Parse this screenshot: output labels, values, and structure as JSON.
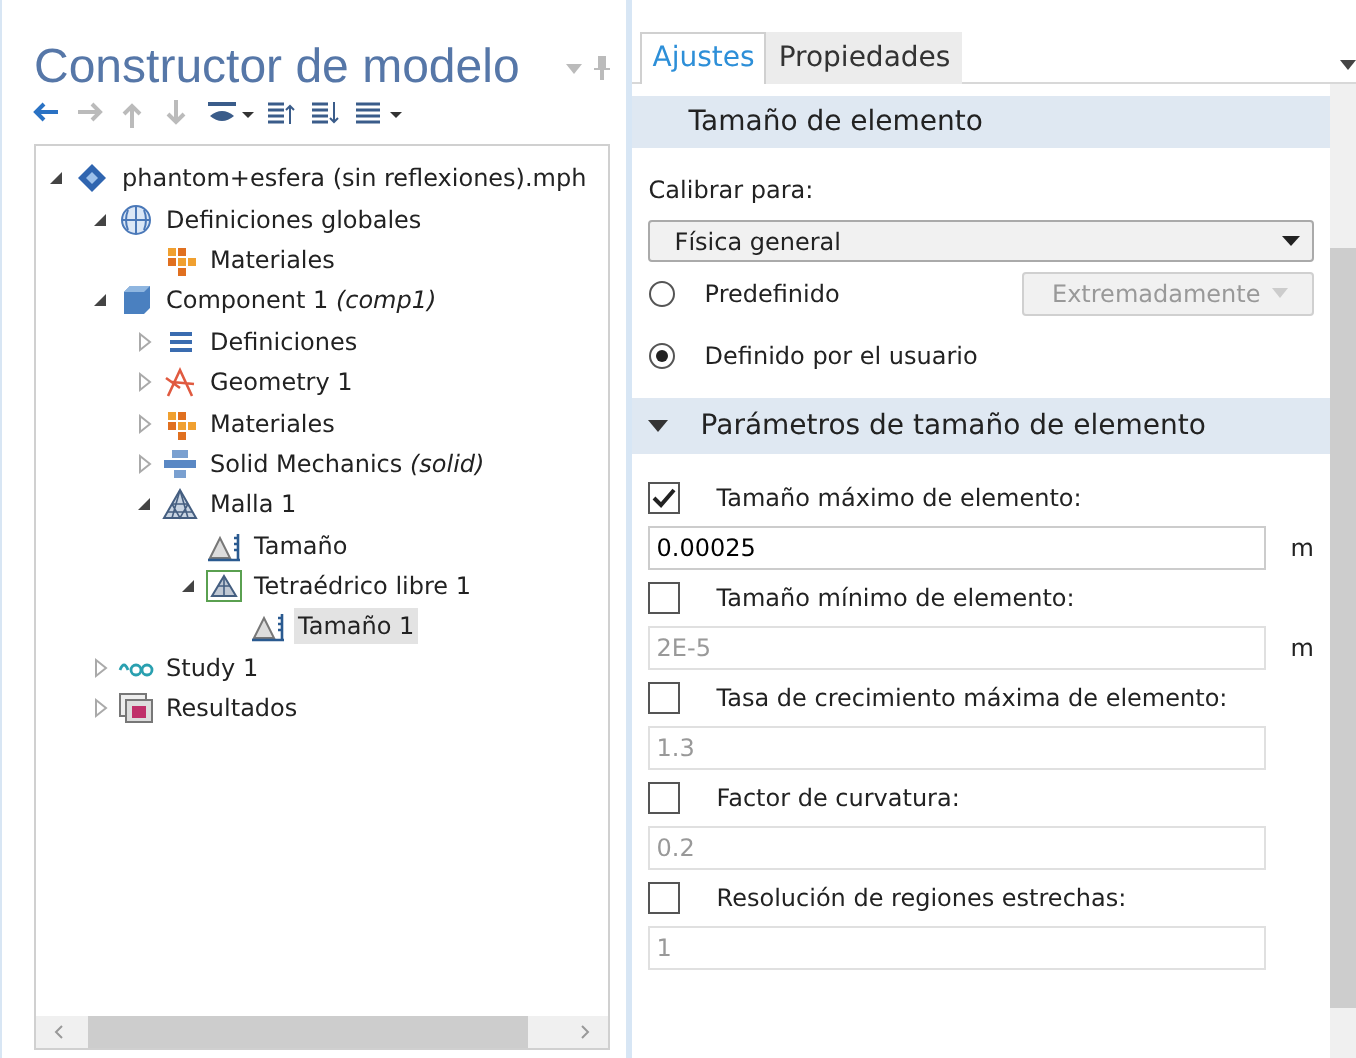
{
  "model_builder": {
    "title": "Constructor de modelo",
    "toolbar": [
      {
        "kind": "back",
        "disabled": false
      },
      {
        "kind": "forward",
        "disabled": true
      },
      {
        "kind": "up",
        "disabled": true
      },
      {
        "kind": "down",
        "disabled": true
      },
      {
        "kind": "show",
        "disabled": false,
        "menu": true
      },
      {
        "kind": "expand",
        "disabled": false
      },
      {
        "kind": "collapse",
        "disabled": false
      },
      {
        "kind": "list",
        "disabled": false,
        "menu": true
      }
    ],
    "tree": [
      {
        "label": "phantom+esfera (sin reflexiones).mph",
        "kind": "file",
        "expanded": true,
        "selected": false,
        "children": [
          {
            "label": "Definiciones globales",
            "kind": "globe",
            "expanded": true,
            "selected": false,
            "children": [
              {
                "label": "Materiales",
                "kind": "materials",
                "selected": false
              }
            ]
          },
          {
            "label": "Component 1 *(comp1)*",
            "kind": "component",
            "expanded": true,
            "selected": false,
            "children": [
              {
                "label": "Definiciones",
                "kind": "definitions",
                "expanded": false,
                "selected": false
              },
              {
                "label": "Geometry 1",
                "kind": "geometry",
                "expanded": false,
                "selected": false
              },
              {
                "label": "Materiales",
                "kind": "materials",
                "expanded": false,
                "selected": false
              },
              {
                "label": "Solid Mechanics *(solid)*",
                "kind": "physics",
                "expanded": false,
                "selected": false
              },
              {
                "label": "Malla 1",
                "kind": "mesh",
                "expanded": true,
                "selected": false,
                "children": [
                  {
                    "label": "Tamaño",
                    "kind": "size",
                    "selected": false
                  },
                  {
                    "label": "Tetraédrico libre 1",
                    "kind": "tetra",
                    "expanded": true,
                    "selected": false,
                    "children": [
                      {
                        "label": "Tamaño 1",
                        "kind": "size",
                        "selected": true
                      }
                    ]
                  }
                ]
              }
            ]
          },
          {
            "label": "Study 1",
            "kind": "study",
            "expanded": false,
            "selected": false
          },
          {
            "label": "Resultados",
            "kind": "results",
            "expanded": false,
            "selected": false
          }
        ]
      }
    ]
  },
  "settings": {
    "tabs": [
      {
        "label": "Ajustes",
        "selected": true
      },
      {
        "label": "Propiedades",
        "selected": false
      }
    ],
    "section_1": {
      "title": "Tamaño de elemento",
      "calibrate_label": "Calibrar para:",
      "calibrate_value": "Física general",
      "options": [
        {
          "label": "Predefinido",
          "selected": false,
          "select_value": "Extremadamente"
        },
        {
          "label": "Definido por el usuario",
          "selected": true
        }
      ]
    },
    "section_2": {
      "title": "Parámetros de tamaño de elemento",
      "expanded": true,
      "parameters": [
        {
          "label": "Tamaño máximo de elemento:",
          "checked": true,
          "value": "0.00025",
          "unit": "m"
        },
        {
          "label": "Tamaño mínimo de elemento:",
          "checked": false,
          "value": "2E-5",
          "unit": "m"
        },
        {
          "label": "Tasa de crecimiento máxima de elemento:",
          "checked": false,
          "value": "1.3"
        },
        {
          "label": "Factor de curvatura:",
          "checked": false,
          "value": "0.2"
        },
        {
          "label": "Resolución de regiones estrechas:",
          "checked": false,
          "value": "1"
        }
      ]
    }
  }
}
